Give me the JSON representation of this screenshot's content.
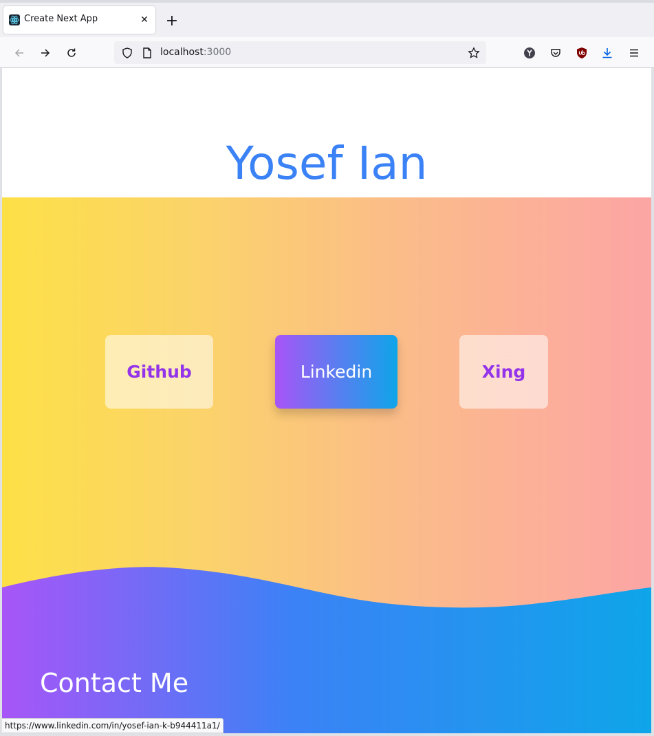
{
  "browser": {
    "tab": {
      "title": "Create Next App",
      "close_glyph": "✕"
    },
    "new_tab_glyph": "+",
    "url": {
      "host": "localhost",
      "port": ":3000"
    },
    "toolbar_icons": [
      "back-icon",
      "forward-icon",
      "reload-icon",
      "shield-icon",
      "page-icon",
      "bookmark-star-icon",
      "yandex-icon",
      "pocket-icon",
      "ublock-icon",
      "download-icon",
      "menu-icon"
    ],
    "status_url": "https://www.linkedin.com/in/yosef-ian-k-b944411a1/"
  },
  "page": {
    "title": "Yosef Ian",
    "links": [
      {
        "label": "Github",
        "active": false
      },
      {
        "label": "Linkedin",
        "active": true
      },
      {
        "label": "Xing",
        "active": false
      }
    ],
    "contact_heading": "Contact Me"
  },
  "colors": {
    "title": "#3b82f6",
    "hero_gradient": [
      "#fde047",
      "#fca5a5"
    ],
    "wave_gradient": [
      "#a855f7",
      "#3b82f6",
      "#0ea5e9"
    ],
    "link_text": "#9333ea"
  }
}
